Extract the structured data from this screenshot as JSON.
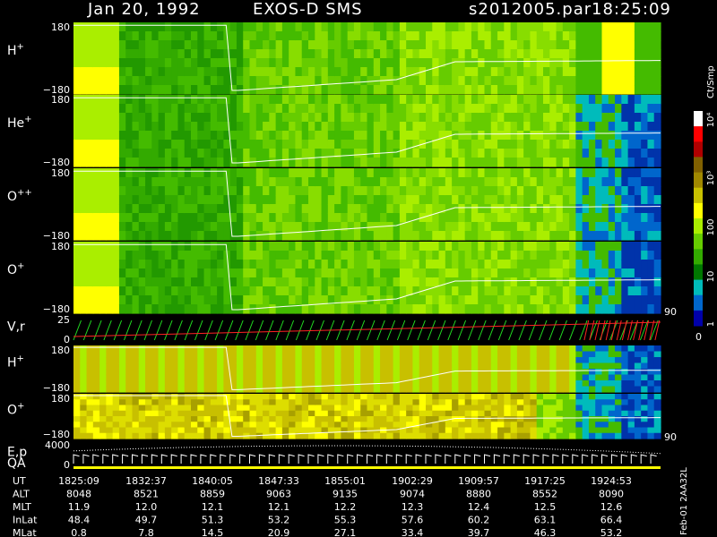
{
  "header": {
    "date": "Jan 20, 1992",
    "instrument": "EXOS-D SMS",
    "file": "s2012005.par",
    "time": "18:25:09"
  },
  "colorbar": {
    "unit": "Ct/Smp",
    "tick_labels": [
      "10⁴",
      "10³",
      "100",
      "10",
      "1"
    ],
    "zero_label": "0",
    "colors": [
      "#ffffff",
      "#ff0000",
      "#b00000",
      "#806000",
      "#a08800",
      "#c8c000",
      "#ffff00",
      "#aaee00",
      "#66cc00",
      "#33aa00",
      "#007700",
      "#00bbbb",
      "#0066cc",
      "#0000aa"
    ]
  },
  "panels": [
    {
      "id": "h1",
      "label": "H",
      "sup": "+",
      "y_top": "180",
      "y_bottom": "−180",
      "kind": "angle"
    },
    {
      "id": "he1",
      "label": "He",
      "sup": "+",
      "y_top": "180",
      "y_bottom": "−180",
      "kind": "angle"
    },
    {
      "id": "oo1",
      "label": "O",
      "sup": "++",
      "y_top": "180",
      "y_bottom": "−180",
      "kind": "angle"
    },
    {
      "id": "o1",
      "label": "O",
      "sup": "+",
      "y_top": "180",
      "y_bottom": "−180",
      "kind": "angle",
      "right_label": "90"
    },
    {
      "id": "vr",
      "label": "V,r",
      "sup": "",
      "y_top": "25",
      "y_bottom": "0",
      "kind": "line"
    },
    {
      "id": "h2",
      "label": "H",
      "sup": "+",
      "y_top": "180",
      "y_bottom": "−180",
      "kind": "angle"
    },
    {
      "id": "o2",
      "label": "O",
      "sup": "+",
      "y_top": "180",
      "y_bottom": "−180",
      "kind": "angle",
      "right_label": "90"
    },
    {
      "id": "ep",
      "label": "E,p",
      "label2": "QA",
      "y_top": "4000",
      "y_bottom": "0",
      "kind": "line"
    }
  ],
  "footer": {
    "row_labels": [
      "UT",
      "ALT",
      "MLT",
      "InLat",
      "MLat"
    ],
    "ut": [
      "1825:09",
      "1832:37",
      "1840:05",
      "1847:33",
      "1855:01",
      "1902:29",
      "1909:57",
      "1917:25",
      "1924:53"
    ],
    "alt": [
      "8048",
      "8521",
      "8859",
      "9063",
      "9135",
      "9074",
      "8880",
      "8552",
      "8090"
    ],
    "mlt": [
      "11.9",
      "12.0",
      "12.1",
      "12.1",
      "12.2",
      "12.3",
      "12.4",
      "12.5",
      "12.6"
    ],
    "inlat": [
      "48.4",
      "49.7",
      "51.3",
      "53.2",
      "55.3",
      "57.6",
      "60.2",
      "63.1",
      "66.4"
    ],
    "mlat": [
      "0.8",
      "7.8",
      "14.5",
      "20.9",
      "27.1",
      "33.4",
      "39.7",
      "46.3",
      "53.2"
    ],
    "side_label": "Feb-01 2AA32L"
  },
  "chart_data": {
    "type": "heatmap",
    "title": "Jan 20, 1992   EXOS-D SMS",
    "x": [
      "1825:09",
      "1832:37",
      "1840:05",
      "1847:33",
      "1855:01",
      "1902:29",
      "1909:57",
      "1917:25",
      "1924:53"
    ],
    "ylim": [
      -180,
      180
    ],
    "colorbar_unit": "Ct/Smp",
    "series": [
      {
        "name": "H+",
        "ylim": [
          -180,
          180
        ]
      },
      {
        "name": "He+",
        "ylim": [
          -180,
          180
        ]
      },
      {
        "name": "O++",
        "ylim": [
          -180,
          180
        ]
      },
      {
        "name": "O+",
        "ylim": [
          -180,
          180
        ]
      },
      {
        "name": "V,r",
        "ylim": [
          0,
          25
        ]
      },
      {
        "name": "H+",
        "ylim": [
          -180,
          180
        ]
      },
      {
        "name": "O+",
        "ylim": [
          -180,
          180
        ]
      },
      {
        "name": "E,p",
        "ylim": [
          0,
          4000
        ]
      }
    ]
  }
}
